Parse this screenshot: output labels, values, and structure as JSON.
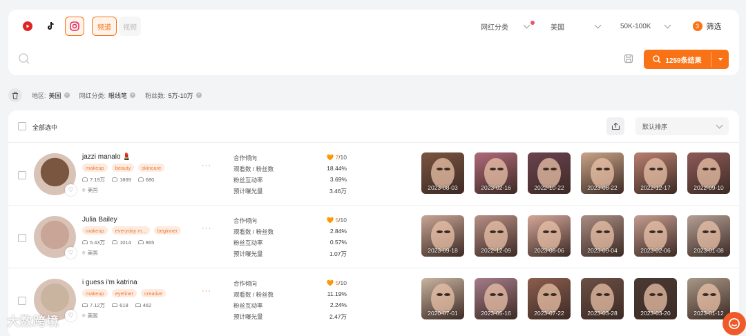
{
  "platforms": [
    {
      "name": "youtube-icon",
      "color": "#ff0000",
      "active": false
    },
    {
      "name": "tiktok-icon",
      "color": "#000000",
      "active": false
    },
    {
      "name": "instagram-icon",
      "color": "#e1306c",
      "active": true
    }
  ],
  "mode_tabs": {
    "channel": "频道",
    "video": "视频"
  },
  "filters": {
    "category_placeholder": "网红分类",
    "region": "美国",
    "followers": "50K-100K",
    "filter_label": "筛选",
    "filter_count": "3"
  },
  "search": {
    "placeholder": "",
    "result_label": "1259条结果"
  },
  "chips": [
    {
      "key": "地区:",
      "value": "美国"
    },
    {
      "key": "网红分类:",
      "value": "眼线笔"
    },
    {
      "key": "粉丝数:",
      "value": "5万-10万"
    }
  ],
  "list": {
    "select_all": "全部选中",
    "sort": "默认排序"
  },
  "metric_labels": [
    "合作倾向",
    "观看数 / 粉丝数",
    "粉丝互动率",
    "预计曝光量"
  ],
  "influencers": [
    {
      "name": "jazzi manalo 💄",
      "tags": [
        "makeup",
        "beauty",
        "skincare"
      ],
      "followers": "7.19万",
      "following": "1869",
      "posts": "680",
      "location": "美国",
      "coop_score": "7",
      "coop_total": "/10",
      "view_ratio": "18.44%",
      "engagement": "3.69%",
      "exposure": "3.46万",
      "thumb_dates": [
        "2023-08-03",
        "2023-02-16",
        "2022-10-22",
        "2023-08-22",
        "2022-12-17",
        "2022-09-10"
      ],
      "colors": [
        "#7a5540",
        "#b06a7a",
        "#6b4350",
        "#c9a488",
        "#b98070",
        "#8e5b58"
      ]
    },
    {
      "name": "Julia Bailey",
      "tags": [
        "makeup",
        "everyday m...",
        "beginner"
      ],
      "followers": "5.43万",
      "following": "1014",
      "posts": "865",
      "location": "美国",
      "coop_score": "5",
      "coop_total": "/10",
      "view_ratio": "2.84%",
      "engagement": "0.57%",
      "exposure": "1.07万",
      "thumb_dates": [
        "2023-09-18",
        "2022-12-09",
        "2023-08-06",
        "2023-09-04",
        "2023-02-06",
        "2023-01-08"
      ],
      "colors": [
        "#c8a596",
        "#b88f86",
        "#d4a79a",
        "#a98d84",
        "#c49c90",
        "#b4a095"
      ]
    },
    {
      "name": "i guess i'm katrina",
      "tags": [
        "makeup",
        "eyeliner",
        "creative"
      ],
      "followers": "7.12万",
      "following": "618",
      "posts": "462",
      "location": "美国",
      "coop_score": "5",
      "coop_total": "/10",
      "view_ratio": "11.19%",
      "engagement": "2.24%",
      "exposure": "2.47万",
      "thumb_dates": [
        "2020-07-01",
        "2023-05-16",
        "2023-07-22",
        "2023-03-28",
        "2023-03-20",
        "2023-01-12"
      ],
      "colors": [
        "#c9b4a0",
        "#a57c8a",
        "#8b5e4e",
        "#6b5045",
        "#4a3a34",
        "#a89886"
      ]
    }
  ],
  "watermark": "大数跨境",
  "accent": "#f97316"
}
